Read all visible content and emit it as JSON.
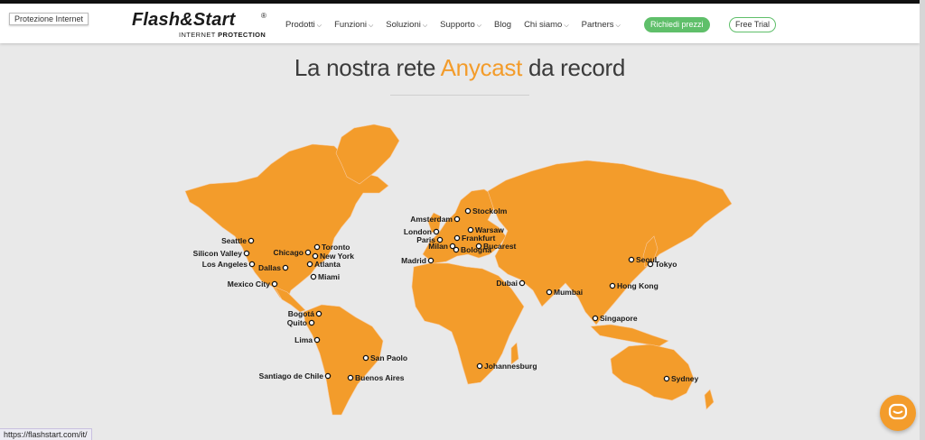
{
  "tooltip": "Protezione Internet",
  "logo": {
    "word": "Flash&Start",
    "sub_light": "INTERNET ",
    "sub_bold": "PROTECTION",
    "reg": "®"
  },
  "nav": [
    {
      "label": "Prodotti",
      "has_dropdown": true
    },
    {
      "label": "Funzioni",
      "has_dropdown": true
    },
    {
      "label": "Soluzioni",
      "has_dropdown": true
    },
    {
      "label": "Supporto",
      "has_dropdown": true
    },
    {
      "label": "Blog",
      "has_dropdown": false
    },
    {
      "label": "Chi siamo",
      "has_dropdown": true
    },
    {
      "label": "Partners",
      "has_dropdown": true
    }
  ],
  "buttons": {
    "quote": "Richiedi prezzi",
    "trial": "Free Trial"
  },
  "title": {
    "before": "La nostra rete ",
    "accent": "Anycast",
    "after": " da record"
  },
  "cities": [
    "Seattle",
    "Silicon Valley",
    "Los Angeles",
    "Chicago",
    "Toronto",
    "New York",
    "Dallas",
    "Atlanta",
    "Miami",
    "Mexico City",
    "Bogotá",
    "Quito",
    "Lima",
    "San Paolo",
    "Santiago de Chile",
    "Buenos Aires",
    "Amsterdam",
    "London",
    "Paris",
    "Stockolm",
    "Warsaw",
    "Frankfurt",
    "Milan",
    "Bologna",
    "Bucarest",
    "Madrid",
    "Dubai",
    "Mumbai",
    "Johannesburg",
    "Seoul",
    "Tokyo",
    "Hong Kong",
    "Singapore",
    "Sydney"
  ],
  "status_url": "https://flashstart.com/it/",
  "colors": {
    "map": "#f39c2b",
    "accent": "#f39c2b",
    "green": "#5fbf6a",
    "background": "#e9e9e9"
  },
  "icons": {
    "chat": "chat-bubble-icon",
    "chevron": "chevron-down-icon"
  }
}
